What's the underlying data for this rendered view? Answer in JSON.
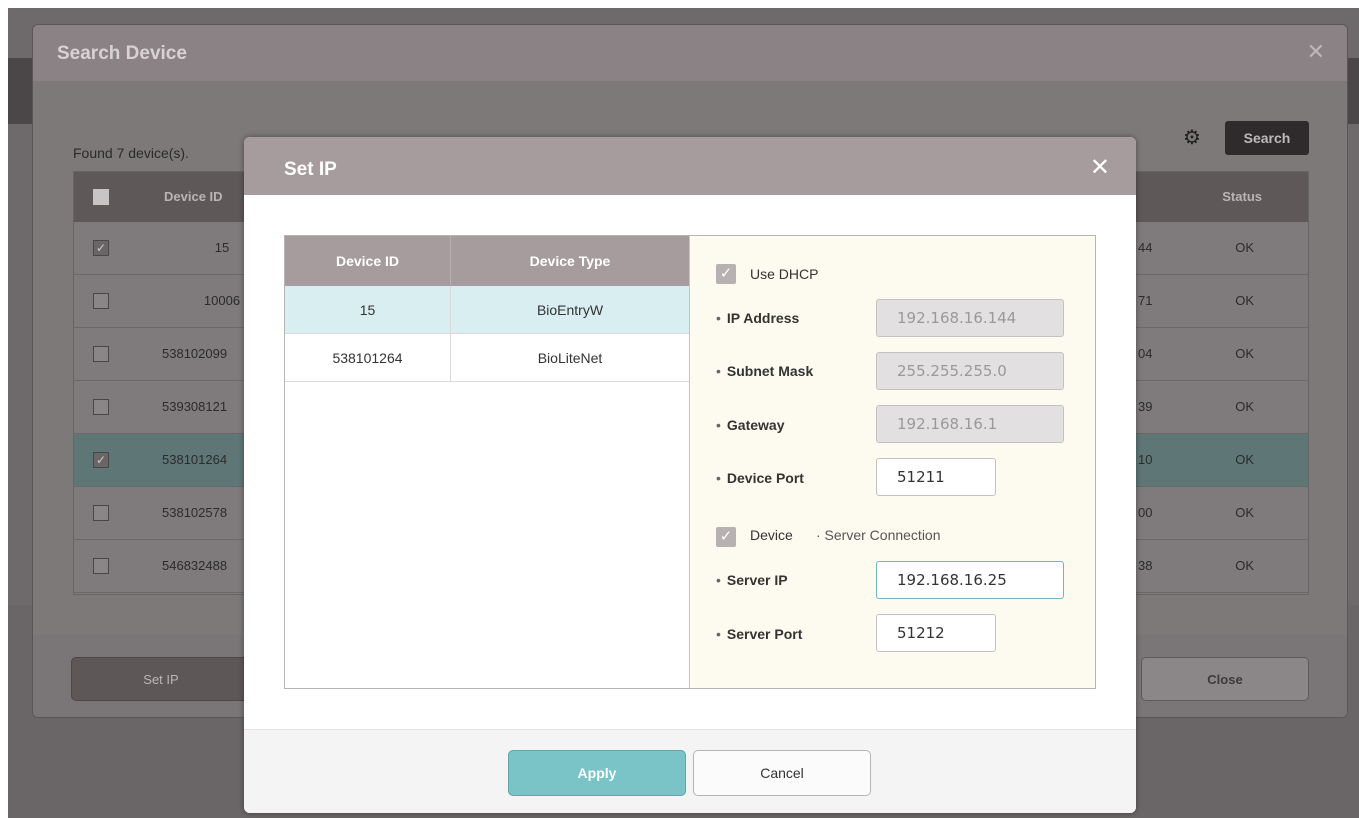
{
  "search_device": {
    "title": "Search Device",
    "close_icon": "close-icon",
    "found_text": "Found 7 device(s).",
    "search_label": "Search",
    "gear_icon": "gear-icon",
    "columns": {
      "device_id": "Device ID",
      "status": "Status"
    },
    "rows": [
      {
        "checked": true,
        "device_id": "15",
        "ip_tail": "44",
        "status": "OK",
        "selected": false
      },
      {
        "checked": false,
        "device_id": "10006",
        "ip_tail": "71",
        "status": "OK",
        "selected": false
      },
      {
        "checked": false,
        "device_id": "538102099",
        "ip_tail": "04",
        "status": "OK",
        "selected": false
      },
      {
        "checked": false,
        "device_id": "539308121",
        "ip_tail": "39",
        "status": "OK",
        "selected": false
      },
      {
        "checked": true,
        "device_id": "538101264",
        "ip_tail": "10",
        "status": "OK",
        "selected": true
      },
      {
        "checked": false,
        "device_id": "538102578",
        "ip_tail": "00",
        "status": "OK",
        "selected": false
      },
      {
        "checked": false,
        "device_id": "546832488",
        "ip_tail": "38",
        "status": "OK",
        "selected": false
      }
    ],
    "set_ip_label": "Set IP",
    "close_label": "Close"
  },
  "set_ip": {
    "title": "Set IP",
    "close_icon": "close-icon",
    "list": {
      "col_device_id": "Device ID",
      "col_device_type": "Device Type",
      "rows": [
        {
          "device_id": "15",
          "device_type": "BioEntryW"
        },
        {
          "device_id": "538101264",
          "device_type": "BioLiteNet"
        }
      ]
    },
    "form": {
      "use_dhcp_label": "Use DHCP",
      "ip_address_label": "IP Address",
      "ip_address_value": "192.168.16.144",
      "subnet_mask_label": "Subnet Mask",
      "subnet_mask_value": "255.255.255.0",
      "gateway_label": "Gateway",
      "gateway_value": "192.168.16.1",
      "device_port_label": "Device Port",
      "device_port_value": "51211",
      "device_label": "Device",
      "server_connection_label": "· Server Connection",
      "server_ip_label": "Server IP",
      "server_ip_value": "192.168.16.25",
      "server_port_label": "Server Port",
      "server_port_value": "51212"
    },
    "apply_label": "Apply",
    "cancel_label": "Cancel"
  },
  "colors": {
    "accent": "#7ac3c7",
    "header": "#a69c9e",
    "form_bg": "#fdfbef"
  }
}
